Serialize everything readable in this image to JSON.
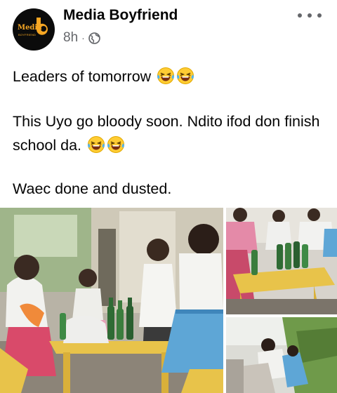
{
  "post": {
    "author": "Media Boyfriend",
    "time": "8h",
    "separator": "·",
    "privacy_icon": "globe-icon",
    "avatar": {
      "logo_word": "Media",
      "logo_letter": "b",
      "logo_sub": "BOYFRIEND"
    },
    "more_icon": "more-dots-icon",
    "text": {
      "line1": "Leaders of tomorrow",
      "line2": "This Uyo go bloody soon. Ndito ifod don finish school da.",
      "line3": "Waec done and dusted."
    },
    "emoji_name": "laughing-tears-emoji"
  },
  "photos": [
    {
      "name": "students-celebrating-with-drinks"
    },
    {
      "name": "bottles-on-yellow-table"
    },
    {
      "name": "students-outdoors-grass"
    }
  ],
  "colors": {
    "text": "#050505",
    "secondary": "#65676b",
    "logo_accent": "#f5a623",
    "table_yellow": "#e8c34a",
    "uniform_blue": "#5ea6d6"
  }
}
